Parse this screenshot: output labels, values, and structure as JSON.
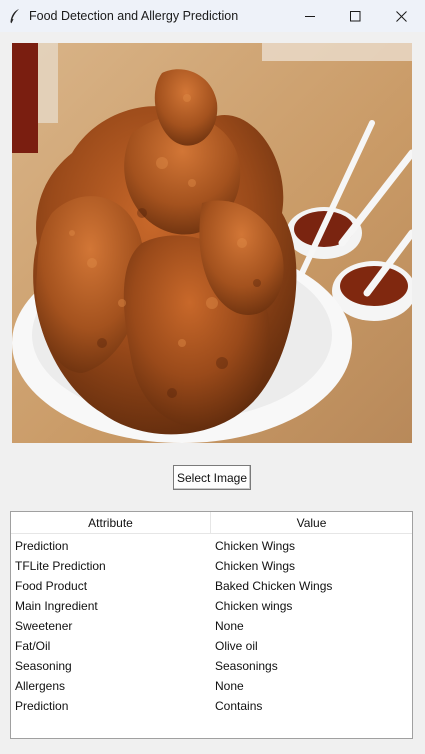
{
  "window": {
    "title": "Food Detection and Allergy Prediction",
    "icon": "feather-icon"
  },
  "image": {
    "description_icon": "chicken-wings-photo"
  },
  "select_button": {
    "label": "Select Image"
  },
  "table": {
    "columns": [
      "Attribute",
      "Value"
    ],
    "rows": [
      {
        "attribute": "Prediction",
        "value": "Chicken Wings"
      },
      {
        "attribute": "TFLite Prediction",
        "value": "Chicken Wings"
      },
      {
        "attribute": "Food Product",
        "value": "Baked Chicken Wings"
      },
      {
        "attribute": "Main Ingredient",
        "value": "Chicken wings"
      },
      {
        "attribute": "Sweetener",
        "value": "None"
      },
      {
        "attribute": "Fat/Oil",
        "value": "Olive oil"
      },
      {
        "attribute": "Seasoning",
        "value": "Seasonings"
      },
      {
        "attribute": "Allergens",
        "value": "None"
      },
      {
        "attribute": "Prediction",
        "value": "Contains"
      }
    ]
  }
}
